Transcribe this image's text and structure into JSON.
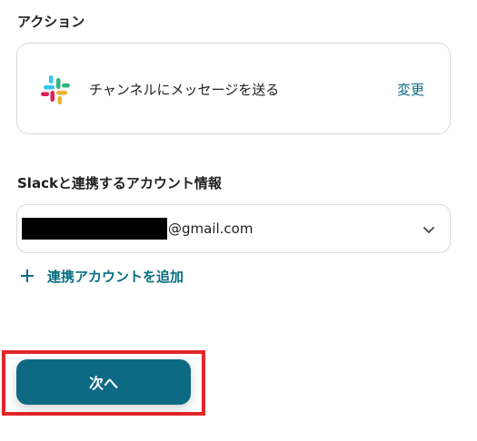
{
  "action_section": {
    "label": "アクション",
    "card": {
      "icon": "slack-logo",
      "action_name": "チャンネルにメッセージを送る",
      "change_label": "変更"
    }
  },
  "account_section": {
    "label": "Slackと連携するアカウント情報",
    "selected_account_suffix": "@gmail.com",
    "add_account_label": "連携アカウントを追加"
  },
  "footer": {
    "next_label": "次へ"
  },
  "colors": {
    "accent": "#0b6e82",
    "button": "#0e6a84",
    "highlight": "#e1262a"
  }
}
